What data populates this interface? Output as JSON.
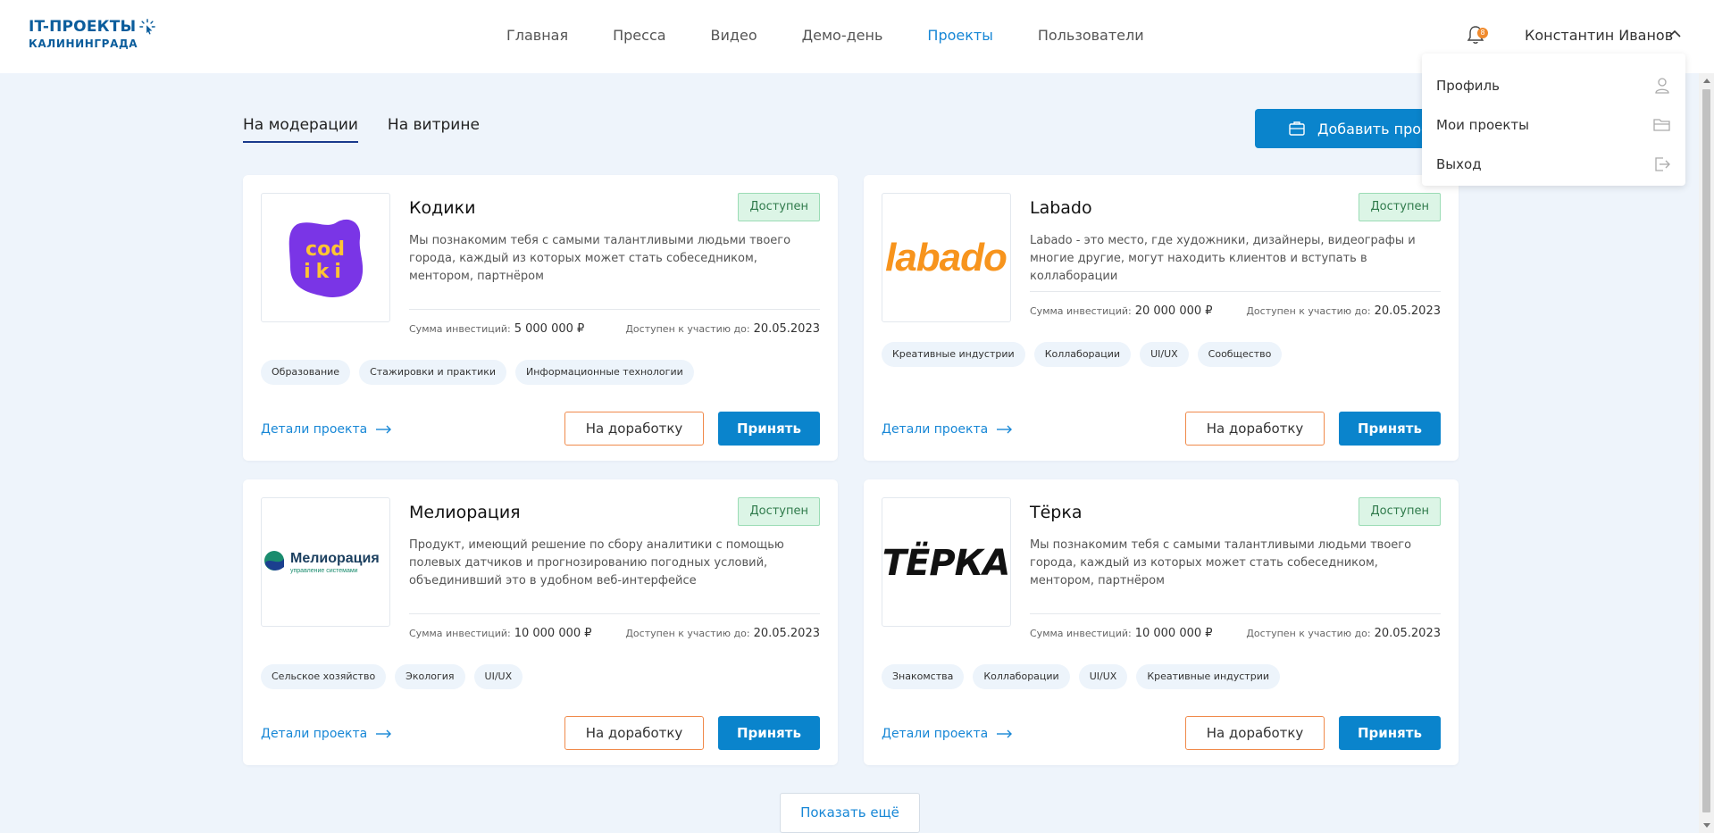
{
  "header": {
    "logo_line1": "IT-ПРОЕКТЫ",
    "logo_line2": "КАЛИНИНГРАДА",
    "nav": [
      {
        "label": "Главная"
      },
      {
        "label": "Пресса"
      },
      {
        "label": "Видео"
      },
      {
        "label": "Демо-день"
      },
      {
        "label": "Проекты",
        "active": true
      },
      {
        "label": "Пользователи"
      }
    ],
    "notification_count": "8",
    "user_name": "Константин Иванов"
  },
  "user_menu": {
    "items": [
      {
        "label": "Профиль",
        "icon": "user-icon"
      },
      {
        "label": "Мои проекты",
        "icon": "folder-icon"
      },
      {
        "label": "Выход",
        "icon": "logout-icon"
      }
    ]
  },
  "tabs": [
    {
      "label": "На модерации",
      "active": true
    },
    {
      "label": "На витрине"
    }
  ],
  "add_project_label": "Добавить проект",
  "labels": {
    "investment": "Сумма инвестиций:",
    "available_until": "Доступен к участию до:",
    "details": "Детали проекта",
    "rework": "На доработку",
    "accept": "Принять"
  },
  "projects": [
    {
      "title": "Кодики",
      "status": "Доступен",
      "description": "Мы познакомим тебя с самыми талантливыми людьми твоего города, каждый из которых может стать собеседником, ментором, партнёром",
      "investment": "5 000 000 ₽",
      "until": "20.05.2023",
      "tags": [
        "Образование",
        "Стажировки и практики",
        "Информационные технологии"
      ],
      "logo_text": [
        "cod",
        "iki"
      ]
    },
    {
      "title": "Labado",
      "status": "Доступен",
      "description": "Labado - это место, где художники, дизайнеры, видеографы и многие другие, могут находить клиентов и вступать в коллаборации",
      "investment": "20 000 000 ₽",
      "until": "20.05.2023",
      "tags": [
        "Креативные индустрии",
        "Коллаборации",
        "UI/UX",
        "Сообщество"
      ],
      "logo_text": [
        "labado"
      ]
    },
    {
      "title": "Мелиорация",
      "status": "Доступен",
      "description": "Продукт, имеющий решение по сбору аналитики с помощью полевых датчиков и прогнозированию погодных условий, объединивший это в удобном веб-интерфейсе",
      "investment": "10 000 000 ₽",
      "until": "20.05.2023",
      "tags": [
        "Сельское хозяйство",
        "Экология",
        "UI/UX"
      ],
      "logo_text": [
        "Мелиорация",
        "управление системами"
      ]
    },
    {
      "title": "Тёрка",
      "status": "Доступен",
      "description": "Мы познакомим тебя с самыми талантливыми людьми твоего города, каждый из которых может стать собеседником, ментором, партнёром",
      "investment": "10 000 000 ₽",
      "until": "20.05.2023",
      "tags": [
        "Знакомства",
        "Коллаборации",
        "UI/UX",
        "Креативные индустрии"
      ],
      "logo_text": [
        "ТЁРКА"
      ]
    }
  ],
  "show_more_label": "Показать ещё",
  "colors": {
    "accent": "#0a84cc",
    "link": "#1787d6",
    "status_bg": "#dcf5e6",
    "rework_border": "#f08a4b",
    "page_bg": "#eef4fb"
  }
}
